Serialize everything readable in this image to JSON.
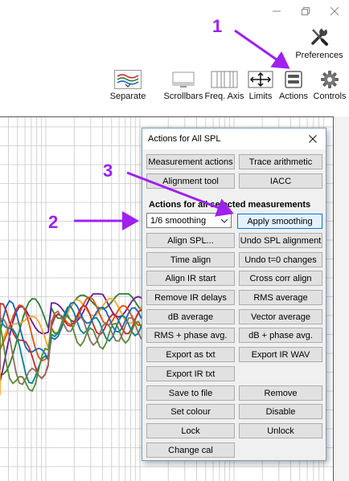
{
  "window": {
    "controls": [
      "minimize",
      "restore",
      "close"
    ]
  },
  "toolbar": {
    "preferences_label": "Preferences",
    "items": [
      {
        "label": "Separate",
        "icon": "separate-traces-icon"
      },
      {
        "label": "Scrollbars",
        "icon": "scrollbars-icon"
      },
      {
        "label": "Freq. Axis",
        "icon": "freq-axis-icon"
      },
      {
        "label": "Limits",
        "icon": "limits-arrows-icon"
      },
      {
        "label": "Actions",
        "icon": "actions-icon"
      },
      {
        "label": "Controls",
        "icon": "gear-icon"
      }
    ]
  },
  "dialog": {
    "title": "Actions for All SPL",
    "top_buttons": [
      "Measurement actions",
      "Trace arithmetic",
      "Alignment tool",
      "IACC"
    ],
    "section_label": "Actions for all selected measurements",
    "smoothing_select": {
      "value": "1/6 smoothing"
    },
    "apply_smoothing": "Apply smoothing",
    "left_buttons": [
      "Align SPL...",
      "Time align",
      "Align IR start",
      "Remove IR delays",
      "dB average",
      "RMS + phase avg.",
      "Export as txt",
      "Export IR txt",
      "Save to file",
      "Set colour",
      "Lock",
      "Change cal"
    ],
    "right_buttons": [
      "Undo SPL alignment",
      "Undo t=0 changes",
      "Cross corr align",
      "RMS average",
      "Vector average",
      "dB + phase avg.",
      "Export IR WAV",
      "Remove",
      "Disable",
      "Unlock"
    ]
  },
  "annotations": {
    "numbers": [
      "1",
      "2",
      "3"
    ],
    "color": "#a020f0"
  },
  "colors": {
    "graph_grid": "#c8c8c8",
    "dialog_border": "#7a9cc2",
    "focus": "#0078d7",
    "traces": [
      "#2e7d32",
      "#6a1b9a",
      "#f9a825",
      "#e65100",
      "#1565c0",
      "#c62828",
      "#00838f",
      "#8d6e63",
      "#558b2f"
    ]
  }
}
